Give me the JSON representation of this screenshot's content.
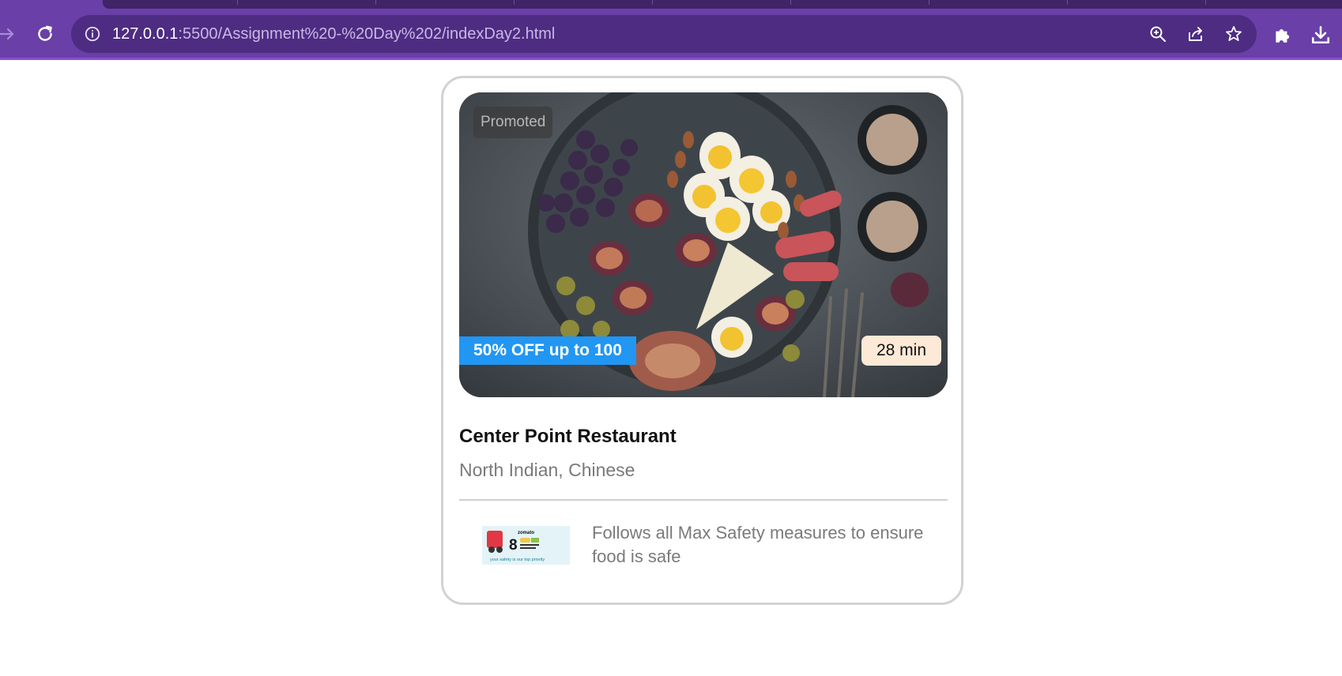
{
  "browser": {
    "url_host": "127.0.0.1",
    "url_path": ":5500/Assignment%20-%20Day%202/indexDay2.html"
  },
  "icons": {
    "forward": "forward-arrow-icon",
    "reload": "reload-icon",
    "info": "info-icon",
    "zoom": "zoom-icon",
    "share": "share-icon",
    "bookmark": "star-icon",
    "extensions": "puzzle-icon",
    "download": "download-icon"
  },
  "colors": {
    "chrome": "#6a3fa8",
    "omnibox": "#4d2c82",
    "offer_badge": "#2196f3",
    "time_badge": "#fde9d6",
    "card_border": "#d2d2d2"
  },
  "card": {
    "promoted": "Promoted",
    "offer": "50% OFF up to 100",
    "time": "28 min",
    "name": "Center Point Restaurant",
    "cuisine": "North Indian, Chinese",
    "safety_text": "Follows all Max Safety measures to ensure food is safe",
    "safety_badge": {
      "brand": "zomato",
      "number": "8",
      "tagline": "your safety is our top priority"
    }
  }
}
